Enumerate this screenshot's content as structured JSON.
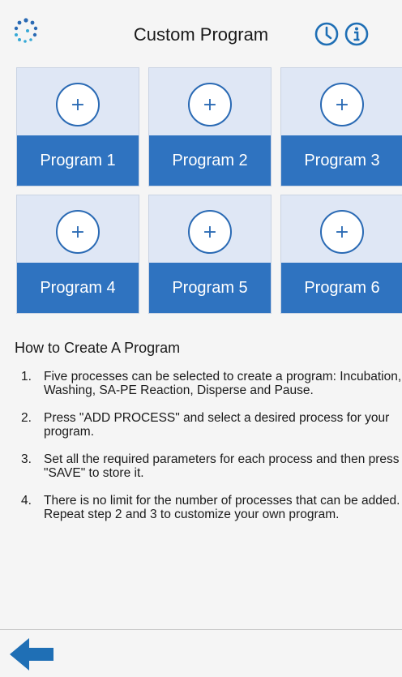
{
  "header": {
    "title": "Custom Program",
    "icons": {
      "logo": "app-logo-icon",
      "clock": "clock-icon",
      "info": "info-icon"
    }
  },
  "programs": [
    {
      "label": "Program 1",
      "plus": "+"
    },
    {
      "label": "Program 2",
      "plus": "+"
    },
    {
      "label": "Program 3",
      "plus": "+"
    },
    {
      "label": "Program 4",
      "plus": "+"
    },
    {
      "label": "Program 5",
      "plus": "+"
    },
    {
      "label": "Program 6",
      "plus": "+"
    }
  ],
  "howto": {
    "title": "How to Create A Program",
    "steps": [
      {
        "num": "1.",
        "text": "Five processes can be selected to create a program: Incubation, Washing, SA-PE Reaction, Disperse and Pause."
      },
      {
        "num": "2.",
        "text": "Press \"ADD PROCESS\" and select a desired process for your program."
      },
      {
        "num": "3.",
        "text": "Set all the required parameters for each process and then press \"SAVE\" to store it."
      },
      {
        "num": "4.",
        "text": "There is no limit for the number of processes that can be added. Repeat step 2 and 3 to customize your own program."
      }
    ]
  },
  "footer": {
    "back_icon": "back-arrow-icon"
  },
  "colors": {
    "accent": "#2f73c0",
    "tile_bg": "#dfe7f5",
    "icon_blue": "#1f6fb5"
  }
}
